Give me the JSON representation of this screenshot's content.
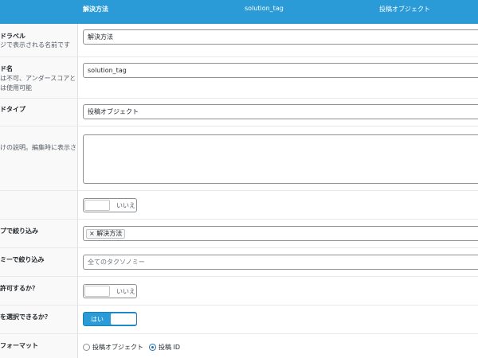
{
  "header": {
    "col1": "解決方法",
    "col2": "solution_tag",
    "col3": "投稿オブジェクト"
  },
  "rows": {
    "field_label": {
      "title": "ドラベル",
      "desc": "ジで表示される名前です",
      "value": "解決方法"
    },
    "field_name": {
      "title": "ド名",
      "desc1": "は不可、アンダースコアと",
      "desc2": "は使用可能",
      "value": "solution_tag"
    },
    "field_type": {
      "title": "ドタイプ",
      "value": "投稿オブジェクト"
    },
    "instructions": {
      "desc": "けの説明。編集時に表示さ"
    },
    "required": {
      "toggle_label": "いいえ"
    },
    "filter_post_type": {
      "title": "プで絞り込み",
      "chip_label": "× 解決方法"
    },
    "filter_taxonomy": {
      "title": "ミーで絞り込み",
      "placeholder": "全てのタクソノミー"
    },
    "allow_null": {
      "title": "許可するか？",
      "toggle_label": "いいえ"
    },
    "multiple": {
      "title": "を選択できるか？",
      "toggle_label": "はい"
    },
    "return_format": {
      "title": "フォーマット",
      "option1": "投稿オブジェクト",
      "option2": "投稿 ID",
      "selected": "option2"
    }
  }
}
